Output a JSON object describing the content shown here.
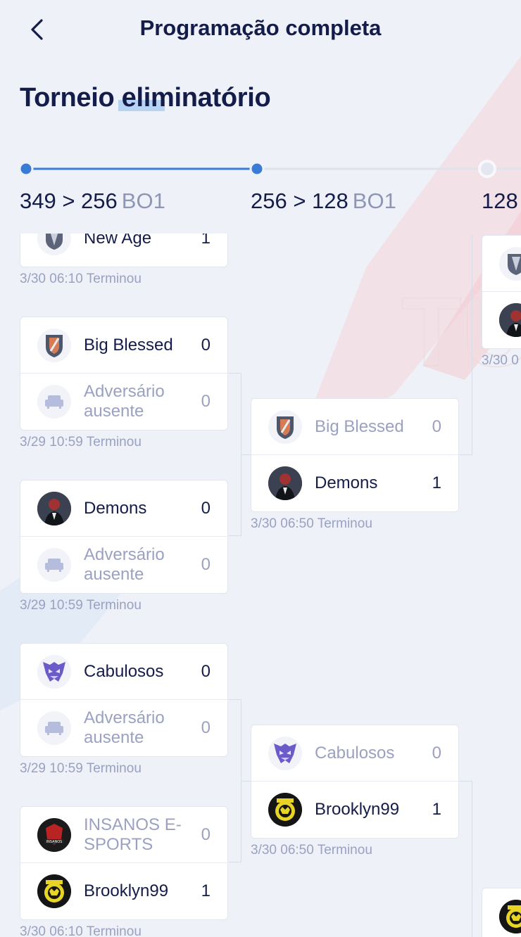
{
  "header": {
    "title": "Programação completa"
  },
  "page": {
    "title": "Torneio eliminatório"
  },
  "rounds": [
    {
      "range": "349 > 256",
      "bo": "BO1"
    },
    {
      "range": "256 > 128",
      "bo": "BO1"
    },
    {
      "range": "128",
      "bo": ""
    }
  ],
  "round1": {
    "m0": {
      "t1": {
        "name": "New Age",
        "score": "1"
      },
      "meta": "3/30 06:10 Terminou"
    },
    "m1": {
      "t1": {
        "name": "Big Blessed",
        "score": "0"
      },
      "t2": {
        "name": "Adversário ausente",
        "score": "0"
      },
      "meta": "3/29 10:59 Terminou"
    },
    "m2": {
      "t1": {
        "name": "Demons",
        "score": "0"
      },
      "t2": {
        "name": "Adversário ausente",
        "score": "0"
      },
      "meta": "3/29 10:59 Terminou"
    },
    "m3": {
      "t1": {
        "name": "Cabulosos",
        "score": "0"
      },
      "t2": {
        "name": "Adversário ausente",
        "score": "0"
      },
      "meta": "3/29 10:59 Terminou"
    },
    "m4": {
      "t1": {
        "name": "INSANOS E-SPORTS",
        "score": "0"
      },
      "t2": {
        "name": "Brooklyn99",
        "score": "1"
      },
      "meta": "3/30 06:10 Terminou"
    }
  },
  "round2": {
    "m0": {
      "t1": {
        "name": "Big Blessed",
        "score": "0"
      },
      "t2": {
        "name": "Demons",
        "score": "1"
      },
      "meta": "3/30 06:50 Terminou"
    },
    "m1": {
      "t1": {
        "name": "Cabulosos",
        "score": "0"
      },
      "t2": {
        "name": "Brooklyn99",
        "score": "1"
      },
      "meta": "3/30 06:50 Terminou"
    }
  },
  "round3": {
    "m0": {
      "meta": "3/30 0"
    }
  },
  "colors": {
    "accent": "#3a7bd5",
    "text": "#141c4a",
    "muted": "#9aa1c2"
  }
}
